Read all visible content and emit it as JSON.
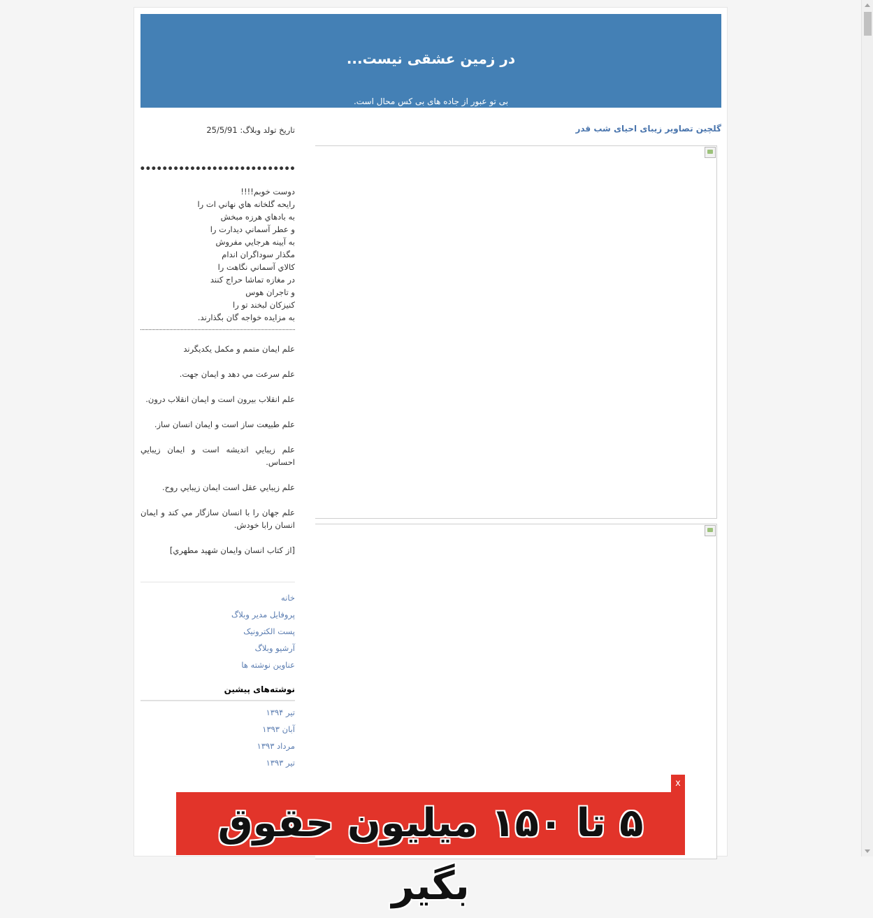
{
  "header": {
    "title": "در زمین عشقی نیست...",
    "description": "بی تو عبور از جاده های بی کس محال است."
  },
  "post": {
    "title": "گلچین تصاویر زیبای احیای شب قدر"
  },
  "sidebar": {
    "birth": "تاریخ تولد وبلاگ: 25/5/91",
    "dots": "•••••••••••••••••••••••••••••••••••",
    "poem": [
      "دوست خوبم!!!!",
      "رايحه گلخانه هاي نهاني ات را",
      "به بادهاي هرزه مبخش",
      "و عطر آسماني ديدارت را",
      "به آيينه هرجايي مفروش",
      "مگذار سوداگران اندام",
      "کالاي آسماني نگاهت را",
      "در مغازه تماشا حراج کنند",
      "و تاجران هوس",
      "کنيزکان لبخند تو را",
      "به مزايده خواجه گان بگذارند."
    ],
    "quotes": [
      "علم ايمان متمم و مکمل يکديگرند",
      "علم سرعت مي دهد و ايمان جهت.",
      "علم انقلاب بيرون است و ايمان انقلاب درون.",
      "علم طبيعت ساز است و ايمان انسان ساز.",
      "علم زيبايي انديشه است و ايمان زيبايي احساس.",
      "علم زيبايي عقل است ايمان زيبايي روح.",
      "علم جهان را با انسان سازگار مي کند و ايمان انسان رابا خودش.",
      "[از کتاب انسان وايمان شهيد مطهري]"
    ],
    "links": [
      "خانه",
      "پروفایل مدیر وبلاگ",
      "پست الکترونیک",
      "آرشیو وبلاگ",
      "عناوین نوشته ها"
    ],
    "archive_title": "نوشته‌های پیشین",
    "archive": [
      "تیر ۱۳۹۴",
      "آبان ۱۳۹۳",
      "مرداد ۱۳۹۳",
      "تیر ۱۳۹۳"
    ]
  },
  "ad": {
    "text": "۵ تا ۱۵۰ میلیون حقوق بگیر",
    "close": "x"
  },
  "colors": {
    "header_bg": "#4480b5",
    "link": "#5a7cb0",
    "ad_bg": "#e2342a"
  }
}
